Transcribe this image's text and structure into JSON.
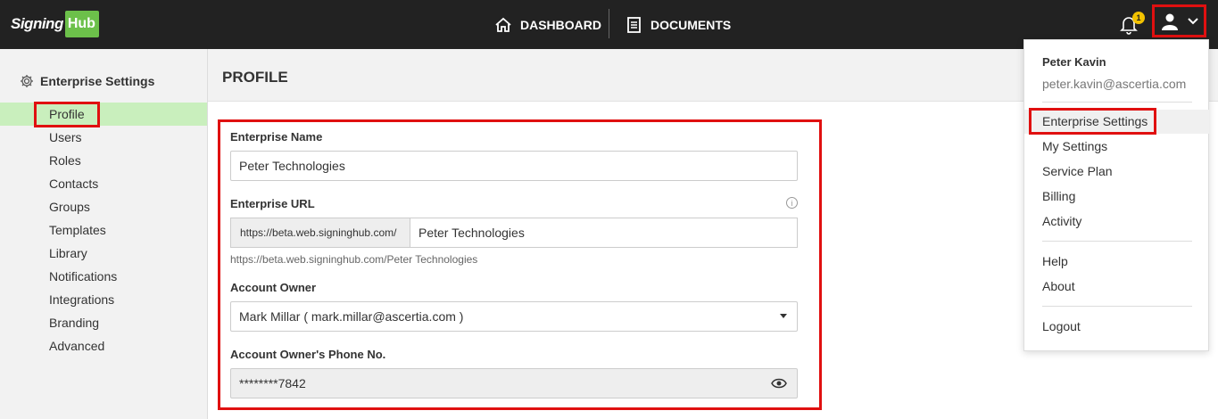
{
  "app": {
    "logo_sign": "Signing",
    "logo_hub": "Hub"
  },
  "nav": {
    "dashboard": "DASHBOARD",
    "documents": "DOCUMENTS"
  },
  "notifications": {
    "count": "1"
  },
  "sidebar": {
    "title": "Enterprise Settings",
    "items": [
      {
        "label": "Profile"
      },
      {
        "label": "Users"
      },
      {
        "label": "Roles"
      },
      {
        "label": "Contacts"
      },
      {
        "label": "Groups"
      },
      {
        "label": "Templates"
      },
      {
        "label": "Library"
      },
      {
        "label": "Notifications"
      },
      {
        "label": "Integrations"
      },
      {
        "label": "Branding"
      },
      {
        "label": "Advanced"
      }
    ]
  },
  "page": {
    "title": "PROFILE"
  },
  "form": {
    "enterprise_name_label": "Enterprise Name",
    "enterprise_name_value": "Peter Technologies",
    "enterprise_url_label": "Enterprise URL",
    "url_prefix": "https://beta.web.signinghub.com/",
    "url_value": "Peter Technologies",
    "url_hint": "https://beta.web.signinghub.com/Peter Technologies",
    "account_owner_label": "Account Owner",
    "account_owner_value": "Mark Millar ( mark.millar@ascertia.com )",
    "phone_label": "Account Owner's Phone No.",
    "phone_value": "********7842"
  },
  "user_menu": {
    "name": "Peter Kavin",
    "email": "peter.kavin@ascertia.com",
    "items": [
      "Enterprise Settings",
      "My Settings",
      "Service Plan",
      "Billing",
      "Activity",
      "Help",
      "About",
      "Logout"
    ]
  },
  "colors": {
    "accent": "#6cc04a",
    "highlight": "#e01010",
    "topbar": "#222222",
    "active_item": "#c9efbd"
  }
}
